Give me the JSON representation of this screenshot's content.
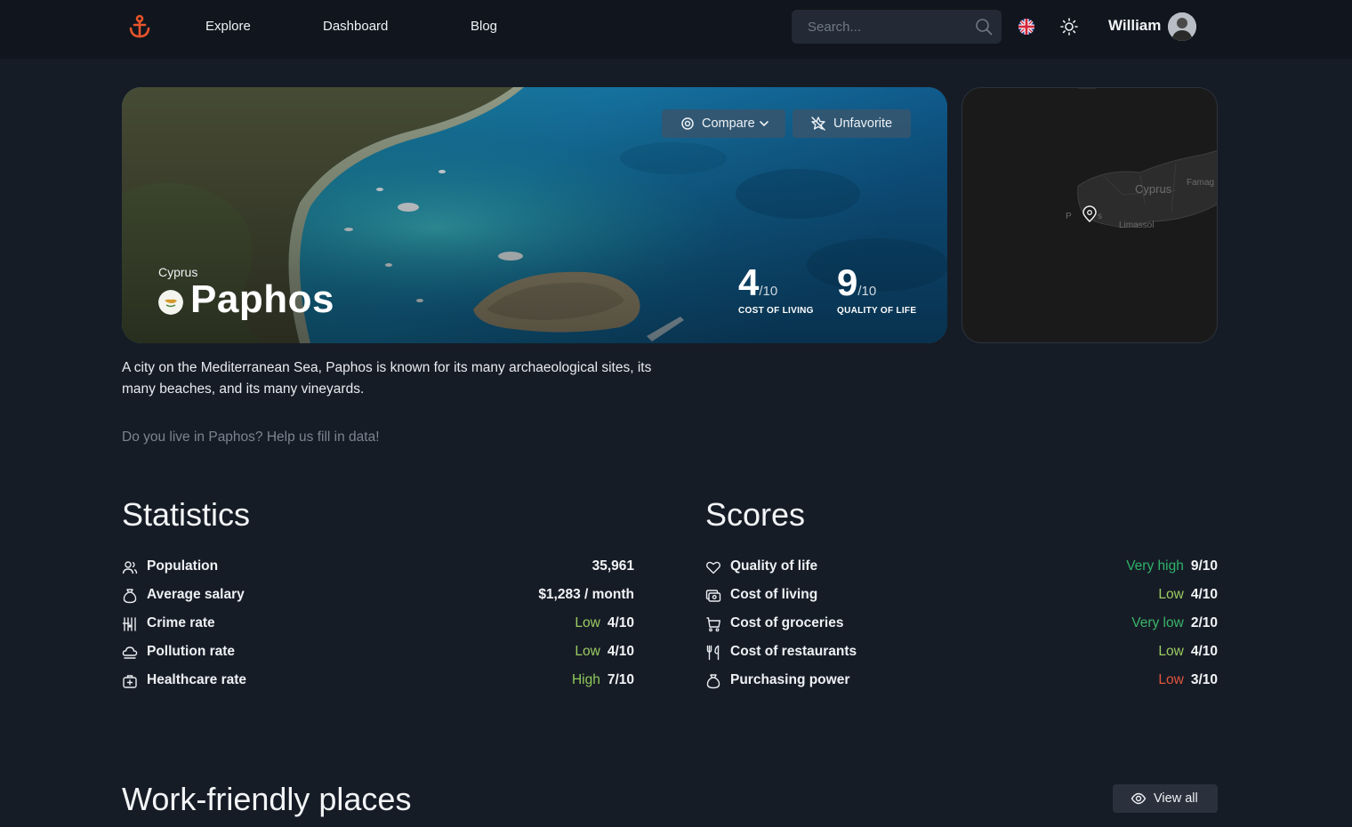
{
  "nav": {
    "links": [
      "Explore",
      "Dashboard",
      "Blog"
    ],
    "search_placeholder": "Search...",
    "username": "William",
    "icons": [
      "anchor-logo-icon",
      "search-icon",
      "uk-flag-icon",
      "sun-icon"
    ]
  },
  "hero": {
    "country": "Cyprus",
    "city": "Paphos",
    "compare_label": "Compare",
    "unfavorite_label": "Unfavorite",
    "scores": [
      {
        "value": "4",
        "denominator": "/10",
        "caption": "COST OF LIVING"
      },
      {
        "value": "9",
        "denominator": "/10",
        "caption": "QUALITY OF LIFE"
      }
    ]
  },
  "map": {
    "labels": [
      "Cyprus",
      "Famag",
      "Limassol",
      "P",
      "s"
    ]
  },
  "description": "A city on the Mediterranean Sea, Paphos is known for its many archaeological sites, its many beaches, and its many vineyards.",
  "help_text": "Do you live in Paphos? Help us fill in data!",
  "statistics": {
    "title": "Statistics",
    "rows": [
      {
        "icon": "users-icon",
        "label": "Population",
        "level": "",
        "value": "35,961"
      },
      {
        "icon": "money-bag-icon",
        "label": "Average salary",
        "level": "",
        "value": "$1,283 / month"
      },
      {
        "icon": "prison-bars-icon",
        "label": "Crime rate",
        "level": "Low",
        "value": "4/10"
      },
      {
        "icon": "cloud-icon",
        "label": "Pollution rate",
        "level": "Low",
        "value": "4/10"
      },
      {
        "icon": "medical-kit-icon",
        "label": "Healthcare rate",
        "level": "High",
        "value": "7/10"
      }
    ]
  },
  "scores": {
    "title": "Scores",
    "rows": [
      {
        "icon": "heart-icon",
        "label": "Quality of life",
        "level": "Very high",
        "value": "9/10"
      },
      {
        "icon": "cash-icon",
        "label": "Cost of living",
        "level": "Low",
        "value": "4/10"
      },
      {
        "icon": "shopping-cart-icon",
        "label": "Cost of groceries",
        "level": "Very low",
        "value": "2/10"
      },
      {
        "icon": "fork-knife-icon",
        "label": "Cost of restaurants",
        "level": "Low",
        "value": "4/10"
      },
      {
        "icon": "money-bag-icon",
        "label": "Purchasing power",
        "level": "Low",
        "value": "3/10"
      }
    ]
  },
  "work_places": {
    "title": "Work-friendly places",
    "view_all_label": "View all"
  },
  "colors": {
    "background": "#161c26",
    "navbar": "#11161e",
    "accent": "#e8542a",
    "level_very_high": "#2fb36a",
    "level_high": "#8ec95a",
    "level_low_good": "#9ccc62",
    "level_very_low": "#3bb56a",
    "level_low_bad": "#e2553d"
  }
}
